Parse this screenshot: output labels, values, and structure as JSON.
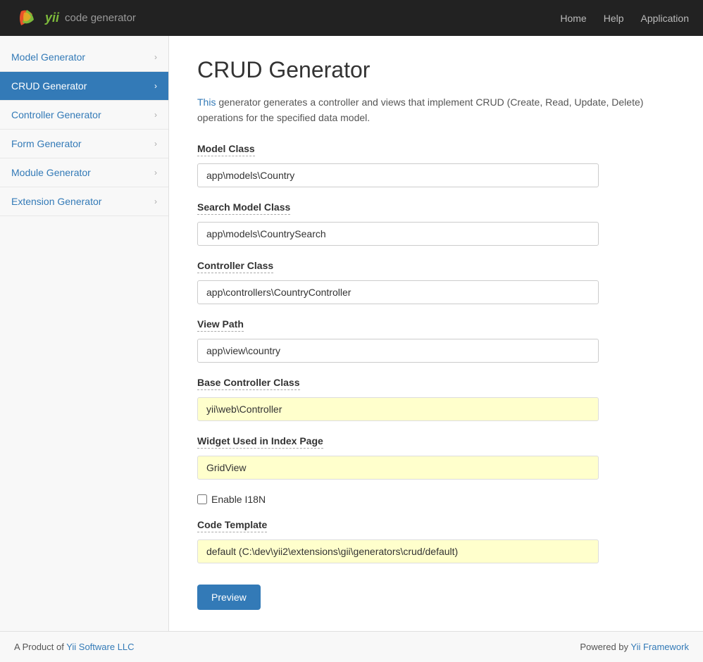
{
  "header": {
    "logo_text": "yii",
    "logo_subtext": " code generator",
    "nav": {
      "home": "Home",
      "help": "Help",
      "application": "Application"
    }
  },
  "sidebar": {
    "items": [
      {
        "id": "model-generator",
        "label": "Model Generator",
        "active": false
      },
      {
        "id": "crud-generator",
        "label": "CRUD Generator",
        "active": true
      },
      {
        "id": "controller-generator",
        "label": "Controller Generator",
        "active": false
      },
      {
        "id": "form-generator",
        "label": "Form Generator",
        "active": false
      },
      {
        "id": "module-generator",
        "label": "Module Generator",
        "active": false
      },
      {
        "id": "extension-generator",
        "label": "Extension Generator",
        "active": false
      }
    ]
  },
  "main": {
    "title": "CRUD Generator",
    "description_prefix": "This",
    "description_rest": " generator generates a controller and views that implement CRUD (Create, Read, Update, Delete) operations for the specified data model.",
    "form": {
      "model_class": {
        "label": "Model Class",
        "value": "app\\models\\Country",
        "placeholder": ""
      },
      "search_model_class": {
        "label": "Search Model Class",
        "value": "app\\models\\CountrySearch",
        "placeholder": ""
      },
      "controller_class": {
        "label": "Controller Class",
        "value": "app\\controllers\\CountryController",
        "placeholder": ""
      },
      "view_path": {
        "label": "View Path",
        "value": "app\\view\\country",
        "placeholder": ""
      },
      "base_controller_class": {
        "label": "Base Controller Class",
        "value": "yii\\web\\Controller",
        "readonly": true
      },
      "widget_used": {
        "label": "Widget Used in Index Page",
        "value": "GridView",
        "readonly": true
      },
      "enable_i18n": {
        "label": "Enable I18N",
        "checked": false
      },
      "code_template": {
        "label": "Code Template",
        "value": "default (C:\\dev\\yii2\\extensions\\gii\\generators\\crud/default)",
        "readonly": true
      },
      "preview_button": "Preview"
    }
  },
  "footer": {
    "left_text": "A Product of ",
    "left_link_text": "Yii Software LLC",
    "right_text": "Powered by ",
    "right_link_text": "Yii Framework"
  }
}
